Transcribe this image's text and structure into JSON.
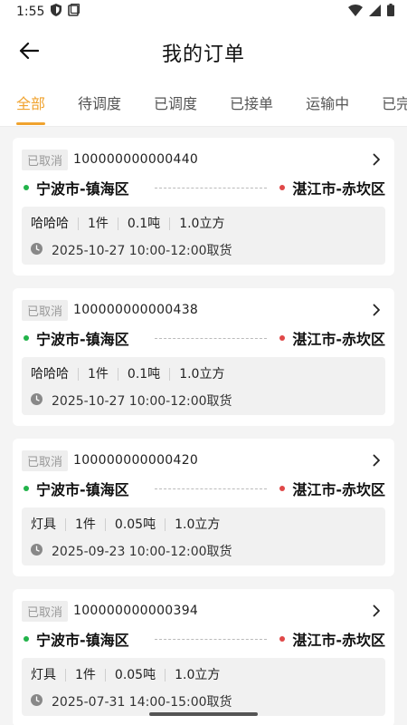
{
  "status_bar": {
    "time": "1:55"
  },
  "header": {
    "title": "我的订单"
  },
  "tabs": [
    {
      "label": "全部",
      "active": true
    },
    {
      "label": "待调度",
      "active": false
    },
    {
      "label": "已调度",
      "active": false
    },
    {
      "label": "已接单",
      "active": false
    },
    {
      "label": "运输中",
      "active": false
    },
    {
      "label": "已完成",
      "active": false
    }
  ],
  "orders": [
    {
      "status": "已取消",
      "order_no": "100000000000440",
      "from": "宁波市-镇海区",
      "to": "湛江市-赤坎区",
      "cargo": "哈哈哈",
      "count": "1件",
      "weight": "0.1吨",
      "volume": "1.0立方",
      "pickup": "2025-10-27 10:00-12:00取货"
    },
    {
      "status": "已取消",
      "order_no": "100000000000438",
      "from": "宁波市-镇海区",
      "to": "湛江市-赤坎区",
      "cargo": "哈哈哈",
      "count": "1件",
      "weight": "0.1吨",
      "volume": "1.0立方",
      "pickup": "2025-10-27 10:00-12:00取货"
    },
    {
      "status": "已取消",
      "order_no": "100000000000420",
      "from": "宁波市-镇海区",
      "to": "湛江市-赤坎区",
      "cargo": "灯具",
      "count": "1件",
      "weight": "0.05吨",
      "volume": "1.0立方",
      "pickup": "2025-09-23 10:00-12:00取货"
    },
    {
      "status": "已取消",
      "order_no": "100000000000394",
      "from": "宁波市-镇海区",
      "to": "湛江市-赤坎区",
      "cargo": "灯具",
      "count": "1件",
      "weight": "0.05吨",
      "volume": "1.0立方",
      "pickup": "2025-07-31 14:00-15:00取货"
    }
  ],
  "colors": {
    "accent": "#f0a32f",
    "origin_dot": "#22b34a",
    "dest_dot": "#e04848",
    "background": "#f4f4f4"
  }
}
